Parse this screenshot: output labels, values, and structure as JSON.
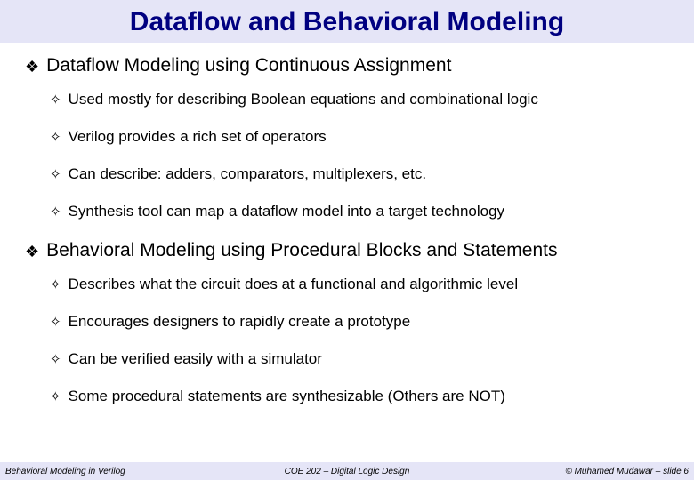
{
  "title": "Dataflow and Behavioral Modeling",
  "sections": [
    {
      "heading": "Dataflow Modeling using Continuous Assignment",
      "items": [
        "Used mostly for describing Boolean equations and combinational logic",
        "Verilog provides a rich set of operators",
        "Can describe: adders, comparators, multiplexers, etc.",
        "Synthesis tool can map a dataflow model into a target technology"
      ]
    },
    {
      "heading": "Behavioral Modeling using Procedural Blocks and Statements",
      "items": [
        "Describes what the circuit does at a functional and algorithmic level",
        "Encourages designers to rapidly create a prototype",
        "Can be verified easily with a simulator",
        "Some procedural statements are synthesizable (Others are NOT)"
      ]
    }
  ],
  "footer": {
    "left": "Behavioral Modeling in Verilog",
    "center": "COE 202 – Digital Logic Design",
    "right": "© Muhamed Mudawar – slide 6"
  },
  "glyphs": {
    "diamond_solid": "❖",
    "diamond_open": "✧"
  }
}
